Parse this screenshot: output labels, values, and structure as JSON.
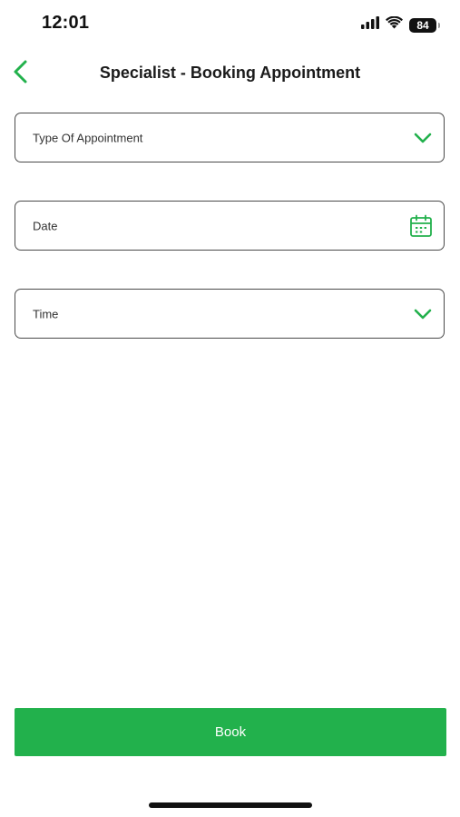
{
  "status_bar": {
    "time": "12:01",
    "battery": "84",
    "icons": [
      "signal-icon",
      "wifi-icon",
      "battery-icon"
    ]
  },
  "header": {
    "title": "Specialist - Booking Appointment",
    "back_icon": "chevron-left-icon"
  },
  "form": {
    "type_of_appointment": {
      "label": "Type Of Appointment",
      "icon": "chevron-down-icon"
    },
    "date": {
      "label": "Date",
      "icon": "calendar-icon"
    },
    "time": {
      "label": "Time",
      "icon": "chevron-down-icon"
    }
  },
  "book_button": {
    "label": "Book"
  },
  "colors": {
    "accent": "#22b14c",
    "border": "#4a4a4a",
    "text": "#1b1b1b"
  }
}
